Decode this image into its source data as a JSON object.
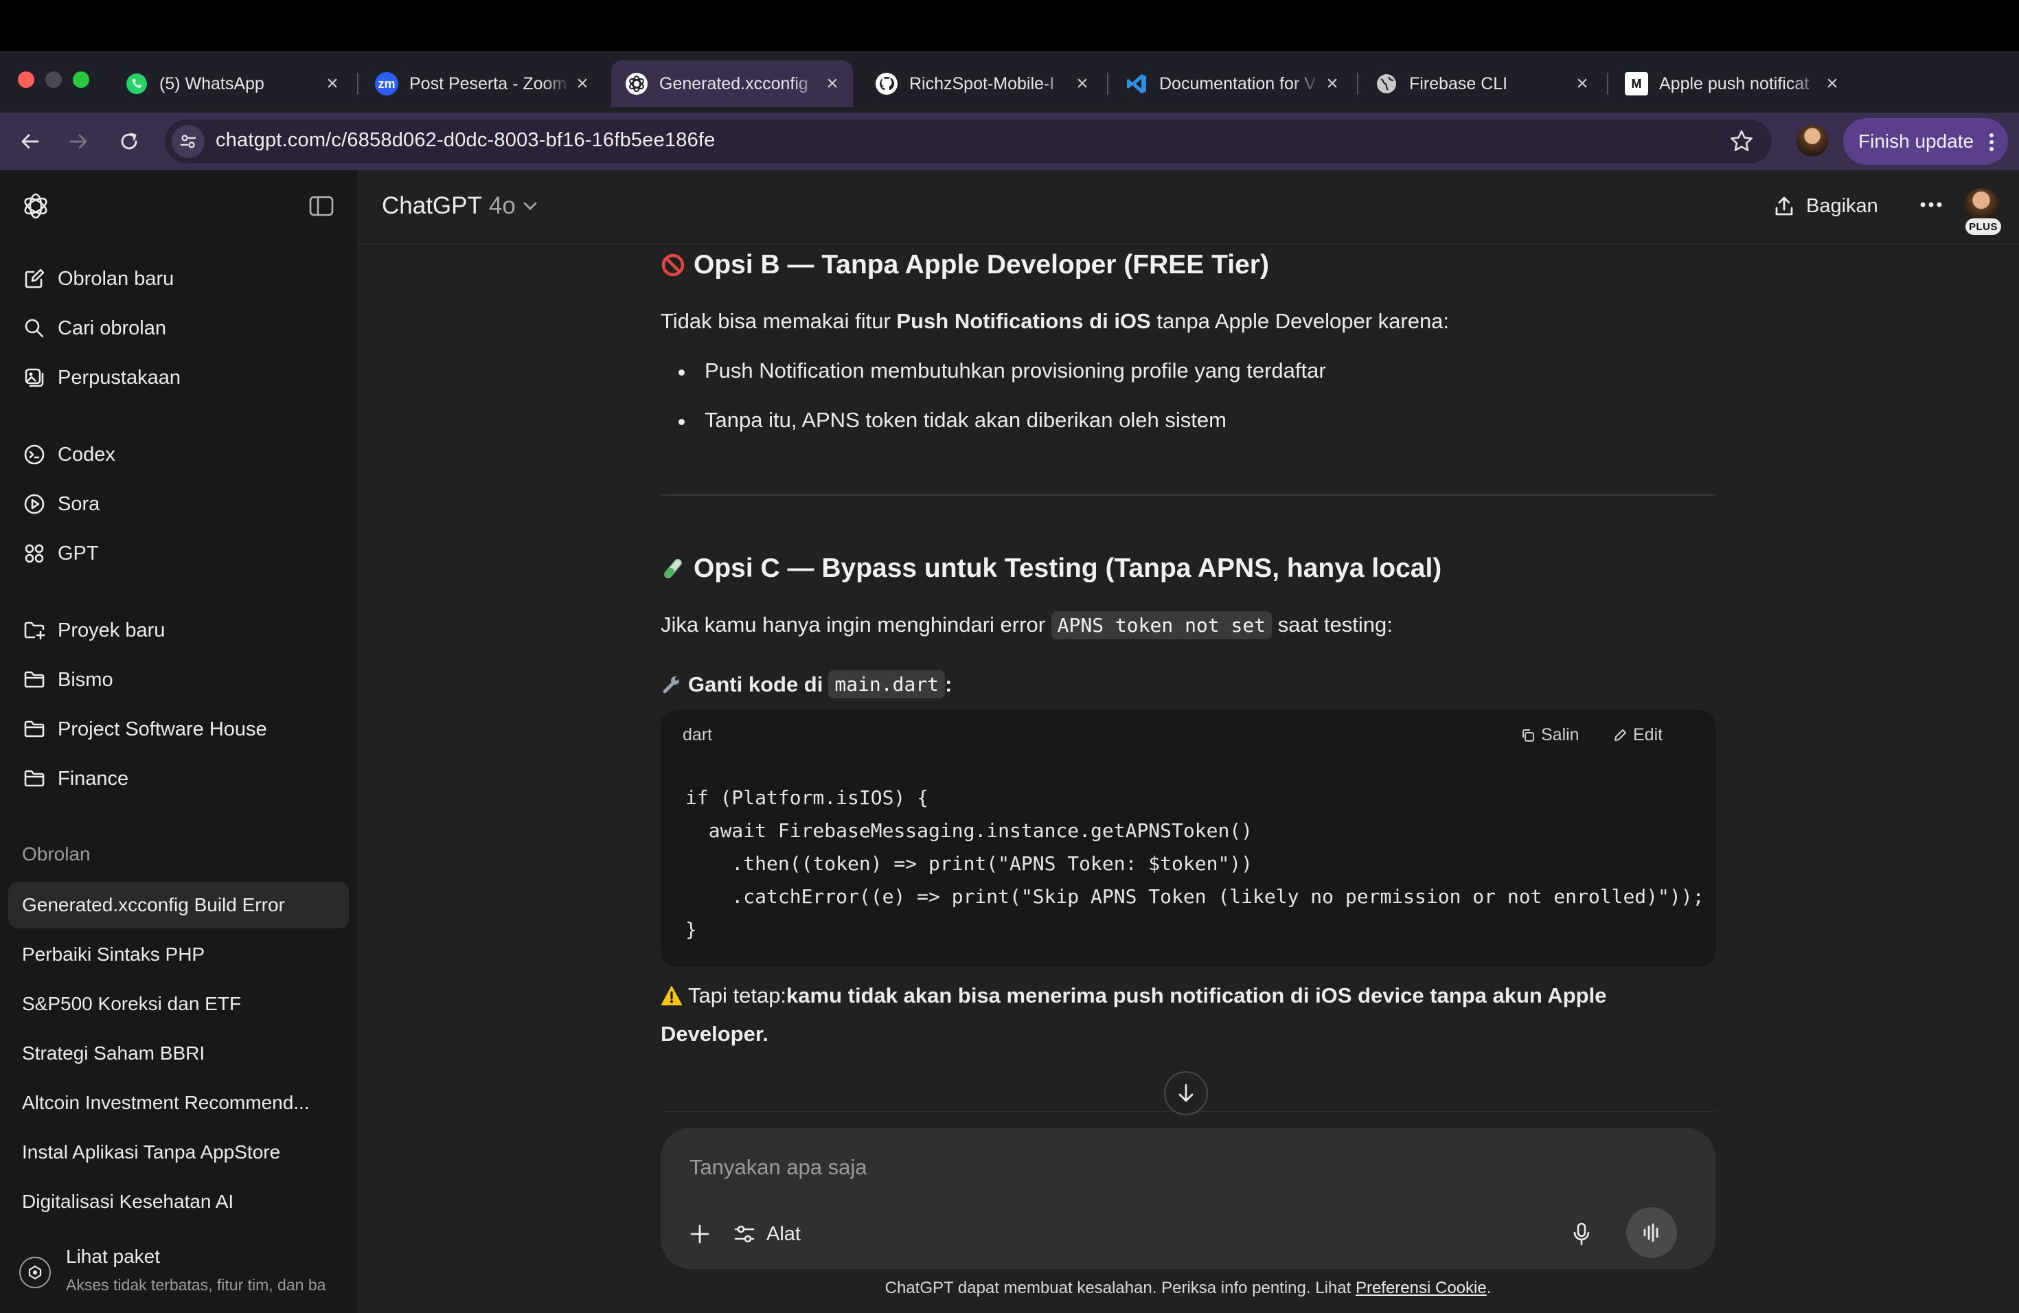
{
  "browser": {
    "tabs": [
      {
        "title": "(5) WhatsApp",
        "icon": "whatsapp-icon",
        "favicon_bg": "#25d366",
        "favicon_text": "",
        "active": false
      },
      {
        "title": "Post Peserta - Zoom",
        "icon": "zoom-icon",
        "favicon_bg": "#2d5ff5",
        "favicon_text": "zm",
        "active": false
      },
      {
        "title": "Generated.xcconfig",
        "icon": "chatgpt-icon",
        "favicon_bg": "#ffffff",
        "favicon_text": "",
        "active": true
      },
      {
        "title": "RichzSpot-Mobile-I",
        "icon": "github-icon",
        "favicon_bg": "#ffffff",
        "favicon_text": "",
        "active": false
      },
      {
        "title": "Documentation for V",
        "icon": "vscode-icon",
        "favicon_bg": "#1f1f27",
        "favicon_text": "",
        "active": false
      },
      {
        "title": "Firebase CLI",
        "icon": "globe-icon",
        "favicon_bg": "#c9c9c9",
        "favicon_text": "",
        "active": false
      },
      {
        "title": "Apple push notificat",
        "icon": "medium-icon",
        "favicon_bg": "#ffffff",
        "favicon_text": "M",
        "active": false
      }
    ],
    "url": "chatgpt.com/c/6858d062-d0dc-8003-bf16-16fb5ee186fe",
    "finish_update_label": "Finish update"
  },
  "sidebar": {
    "nav": [
      {
        "label": "Obrolan baru",
        "icon": "compose-icon"
      },
      {
        "label": "Cari obrolan",
        "icon": "search-icon"
      },
      {
        "label": "Perpustakaan",
        "icon": "library-icon"
      }
    ],
    "tools": [
      {
        "label": "Codex",
        "icon": "codex-icon"
      },
      {
        "label": "Sora",
        "icon": "sora-icon"
      },
      {
        "label": "GPT",
        "icon": "gpt-grid-icon"
      }
    ],
    "projects": [
      {
        "label": "Proyek baru",
        "icon": "new-folder-icon"
      },
      {
        "label": "Bismo",
        "icon": "folder-icon"
      },
      {
        "label": "Project Software House",
        "icon": "folder-icon"
      },
      {
        "label": "Finance",
        "icon": "folder-icon"
      }
    ],
    "chats_heading": "Obrolan",
    "chats": [
      {
        "label": "Generated.xcconfig Build Error",
        "active": true
      },
      {
        "label": "Perbaiki Sintaks PHP",
        "active": false
      },
      {
        "label": "S&P500 Koreksi dan ETF",
        "active": false
      },
      {
        "label": "Strategi Saham BBRI",
        "active": false
      },
      {
        "label": "Altcoin Investment Recommend...",
        "active": false
      },
      {
        "label": "Instal Aplikasi Tanpa AppStore",
        "active": false
      },
      {
        "label": "Digitalisasi Kesehatan AI",
        "active": false
      }
    ],
    "plan": {
      "title": "Lihat paket",
      "subtitle": "Akses tidak terbatas, fitur tim, dan ba"
    }
  },
  "header": {
    "title": "ChatGPT",
    "model": "4o",
    "share_label": "Bagikan",
    "plan_badge": "PLUS"
  },
  "message": {
    "opsi_b": {
      "heading": "Opsi B — Tanpa Apple Developer (FREE Tier)",
      "intro_pre": "Tidak bisa memakai fitur ",
      "intro_bold": "Push Notifications di iOS",
      "intro_post": " tanpa Apple Developer karena:",
      "bullets": [
        "Push Notification membutuhkan provisioning profile yang terdaftar",
        "Tanpa itu, APNS token tidak akan diberikan oleh sistem"
      ]
    },
    "opsi_c": {
      "heading": "Opsi C — Bypass untuk Testing (Tanpa APNS, hanya local)",
      "intro_pre": "Jika kamu hanya ingin menghindari error ",
      "intro_code": "APNS token not set",
      "intro_post": " saat testing:",
      "step_pre": "Ganti kode di ",
      "step_code": "main.dart",
      "step_post": ":",
      "code": {
        "lang": "dart",
        "copy_label": "Salin",
        "edit_label": "Edit",
        "source": "if (Platform.isIOS) {\n  await FirebaseMessaging.instance.getAPNSToken()\n    .then((token) => print(\"APNS Token: $token\"))\n    .catchError((e) => print(\"Skip APNS Token (likely no permission or not enrolled)\"));\n}"
      },
      "warning_pre": "Tapi tetap: ",
      "warning_bold_1": "kamu tidak akan bisa menerima push notification di iOS device tanpa akun Apple",
      "warning_bold_2": "Developer."
    }
  },
  "composer": {
    "placeholder": "Tanyakan apa saja",
    "tools_label": "Alat"
  },
  "footer": {
    "disclaimer": "ChatGPT dapat membuat kesalahan. Periksa info penting. Lihat ",
    "link": "Preferensi Cookie",
    "end": "."
  }
}
